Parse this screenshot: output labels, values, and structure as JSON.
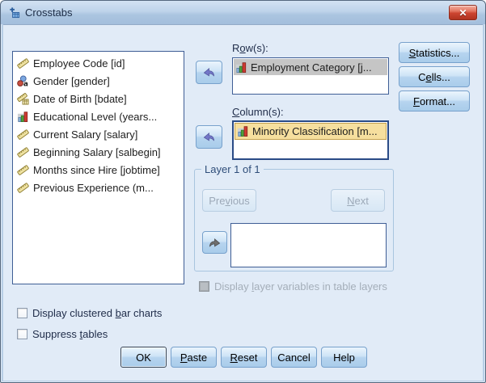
{
  "titlebar": {
    "title": "Crosstabs",
    "close_glyph": "✕"
  },
  "variables": {
    "items": [
      {
        "label": "Employee Code [id]",
        "icon": "scale-icon"
      },
      {
        "label": "Gender [gender]",
        "icon": "nominal-icon"
      },
      {
        "label": "Date of Birth [bdate]",
        "icon": "scale-date-icon"
      },
      {
        "label": "Educational Level (years...",
        "icon": "ordinal-icon"
      },
      {
        "label": "Current Salary [salary]",
        "icon": "scale-icon"
      },
      {
        "label": "Beginning Salary [salbegin]",
        "icon": "scale-icon"
      },
      {
        "label": "Months since Hire [jobtime]",
        "icon": "scale-icon"
      },
      {
        "label": "Previous Experience (m...",
        "icon": "scale-icon"
      }
    ]
  },
  "rows": {
    "label": {
      "pre": "R",
      "key": "o",
      "post": "w(s):"
    },
    "items": [
      {
        "label": "Employment Category [j...",
        "icon": "ordinal-icon",
        "state": "selected"
      }
    ]
  },
  "columns": {
    "label": {
      "pre": "",
      "key": "C",
      "post": "olumn(s):"
    },
    "items": [
      {
        "label": "Minority Classification [m...",
        "icon": "ordinal-icon",
        "state": "focused"
      }
    ]
  },
  "layer": {
    "title": "Layer 1 of 1",
    "previous_button": {
      "pre": "Pre",
      "key": "v",
      "post": "ious",
      "enabled": false
    },
    "next_button": {
      "pre": "",
      "key": "N",
      "post": "ext",
      "enabled": false
    },
    "display_layers_checkbox": {
      "pre": "Display ",
      "key": "l",
      "post": "ayer variables in table layers",
      "checked": false,
      "enabled": false
    }
  },
  "options": {
    "clustered_bar_checkbox": {
      "pre": "Display clustered ",
      "key": "b",
      "post": "ar charts",
      "checked": false
    },
    "suppress_tables_checkbox": {
      "pre": "Suppress ",
      "key": "t",
      "post": "ables",
      "checked": false
    }
  },
  "side_buttons": {
    "statistics": {
      "pre": "",
      "key": "S",
      "post": "tatistics..."
    },
    "cells": {
      "pre": "C",
      "key": "e",
      "post": "lls..."
    },
    "format": {
      "pre": "",
      "key": "F",
      "post": "ormat..."
    }
  },
  "actions": {
    "ok": {
      "pre": "OK",
      "key": "",
      "post": ""
    },
    "paste": {
      "pre": "",
      "key": "P",
      "post": "aste"
    },
    "reset": {
      "pre": "",
      "key": "R",
      "post": "eset"
    },
    "cancel": {
      "pre": "Cancel",
      "key": "",
      "post": ""
    },
    "help": {
      "pre": "Help",
      "key": "",
      "post": ""
    }
  },
  "colors": {
    "selected_item_bg": "#C5C5C5",
    "focused_item_bg": "#F6DF9E",
    "close_button": "#C43C2A",
    "dialog_bg": "#E1EBF7"
  }
}
